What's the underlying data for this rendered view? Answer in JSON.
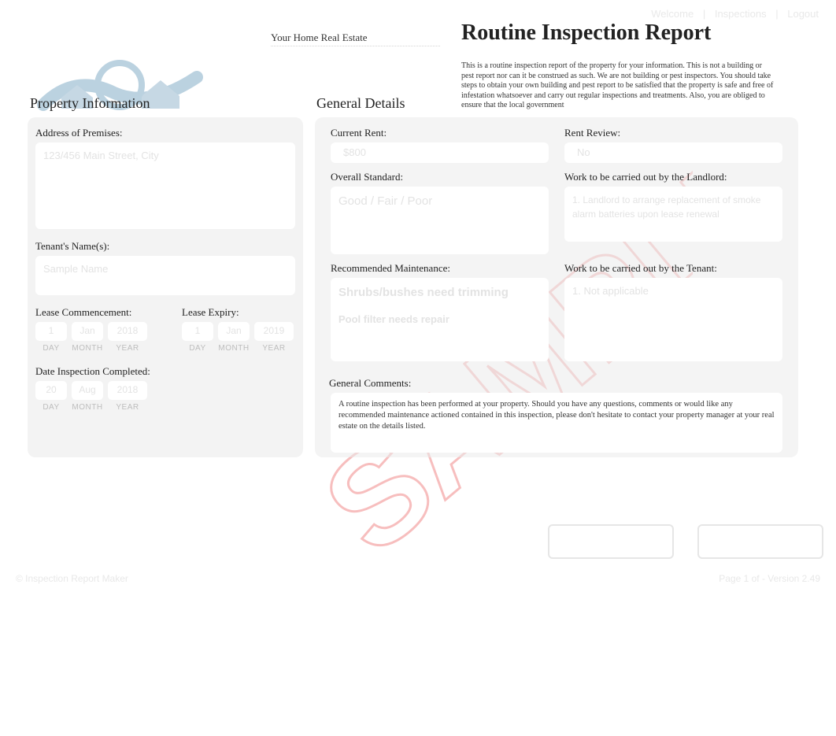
{
  "topnav": {
    "a": "Welcome",
    "b": "Inspections",
    "c": "Logout"
  },
  "header": {
    "agency": "Your Home Real Estate",
    "title": "Routine Inspection Report",
    "disclaimer": "This is a routine inspection report of the property for your information. This is not a building or pest report nor can it be construed as such. We are not building or pest inspectors. You should take steps to obtain your own building and pest report to be satisfied that the property is safe and free of infestation whatsoever and carry out regular inspections and treatments. Also, you are obliged to ensure that the local government"
  },
  "sections": {
    "property": "Property Information",
    "general": "General Details"
  },
  "property": {
    "address_label": "Address of Premises:",
    "address_value": "123/456 Main Street, City",
    "tenant_label": "Tenant's Name(s):",
    "tenant_value": "Sample Name",
    "lease_comm_label": "Lease Commencement:",
    "lease_exp_label": "Lease Expiry:",
    "insp_label": "Date Inspection Completed:",
    "lease_comm": {
      "day": "1",
      "month": "Jan",
      "year": "2018"
    },
    "lease_exp": {
      "day": "1",
      "month": "Jan",
      "year": "2019"
    },
    "insp_date": {
      "day": "20",
      "month": "Aug",
      "year": "2018"
    },
    "dmy": {
      "day": "DAY",
      "month": "MONTH",
      "year": "YEAR"
    }
  },
  "general": {
    "rent_label": "Current Rent:",
    "rent_value": "$800",
    "review_label": "Rent Review:",
    "review_value": "No",
    "overall_label": "Overall Standard:",
    "overall_value": "Good / Fair / Poor",
    "landlord_label": "Work to be carried out by the Landlord:",
    "landlord_value": "1. Landlord to arrange replacement of smoke alarm batteries upon lease renewal",
    "maint_label": "Recommended Maintenance:",
    "maint_value_1": "Shrubs/bushes need trimming",
    "maint_value_2": "Pool filter needs repair",
    "tenant_work_label": "Work to be carried out by the Tenant:",
    "tenant_work_value": "1. Not applicable",
    "comments_label": "General Comments:",
    "comments_value": "A routine inspection has been performed at your property. Should you have any questions, comments or would like any recommended maintenance actioned contained in this inspection, please don't hesitate to contact your property manager at your real estate on the details listed."
  },
  "footer": {
    "left": "© Inspection Report Maker",
    "right": "Page 1 of - Version 2.49"
  }
}
